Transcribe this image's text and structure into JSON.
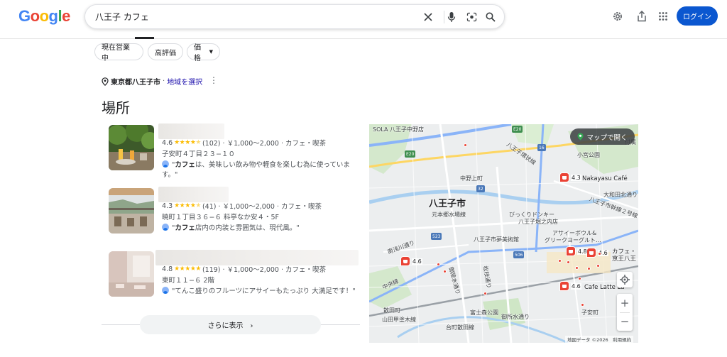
{
  "header": {
    "logo": "Google",
    "search": {
      "value": "八王子 カフェ",
      "placeholder": ""
    },
    "login_label": "ログイン",
    "colors": {
      "accent": "#0b57d0"
    }
  },
  "chips": [
    "現在営業中",
    "高評価",
    "価格"
  ],
  "location": {
    "city": "東京都八王子市",
    "separator": "·",
    "change_link": "地域を選択"
  },
  "section_title": "場所",
  "places": [
    {
      "rating": "4.6",
      "stars": 4.5,
      "meta": "(102) · ￥1,000～2,000 · カフェ・喫茶",
      "address": "子安町４丁目２３−１０",
      "review_bold": "カフェ",
      "review_text": "は、美味しい飲み物や軽食を楽しむ為に使っていま",
      "review_suffix": "す。\"",
      "review_prefix": "\""
    },
    {
      "rating": "4.3",
      "stars": 4.5,
      "meta": "(41) · ￥1,000～2,000 · カフェ・喫茶",
      "address": "暁町１丁目３６−６ 料亭なか安４・5F",
      "review_bold": "カフェ",
      "review_text": "店内の内装と雰囲気は、現代風。\"",
      "review_suffix": "",
      "review_prefix": "\""
    },
    {
      "rating": "4.8",
      "stars": 5,
      "meta": "(119) · ￥1,000～2,000 · カフェ・喫茶",
      "address": "東町１１−６ 2階",
      "review_bold": "",
      "review_text": "\"てんこ盛りのフルーツにアサイーもたっぷり 大満足です！\"",
      "review_suffix": "",
      "review_prefix": ""
    }
  ],
  "more_button": "さらに表示",
  "map": {
    "open_button": "マップで開く",
    "labels": {
      "sola": "SOLA 八王子中野店",
      "city": "八王子市",
      "hachioji_kansen": "八王子環状線",
      "koyasu_park": "小宮公園",
      "nakano_kamicho": "中野上町",
      "motohongo": "元本郷水場線",
      "donki": "びっくりドンキー",
      "donki2": "八王子堀之内店",
      "yume": "八王子市夢美術館",
      "nakayasu": "Nakayasu Café",
      "owada": "大和田北通り",
      "hachioji_kansen2": "八王子市幹線２号線",
      "acai": "アサイーボウル&",
      "acai2": "グリークヨーグルト…",
      "cafe_keio": "カフェ・",
      "cafe_keio2": "京王八王",
      "latte": "Cafe Latte La",
      "nanyo": "南浅川通り",
      "chuo": "中央線",
      "goryo": "御陵水通り",
      "matsueda": "松枝通り",
      "fujimori": "富士森公園",
      "goryo2": "御所水通り",
      "sodai": "散田町",
      "yamada": "山田甲塗木線",
      "daimachi": "台町散田線",
      "koyasu": "子安町",
      "tsuki": "付属"
    },
    "pins": [
      {
        "rating": "4.3"
      },
      {
        "rating": "4.8"
      },
      {
        "rating": "4.6"
      },
      {
        "rating": "4.6"
      },
      {
        "rating": "4.6"
      }
    ],
    "shields": [
      "E20",
      "16",
      "E20",
      "32",
      "506",
      "523"
    ],
    "attribution": "地図データ ©2026　利用規約"
  }
}
